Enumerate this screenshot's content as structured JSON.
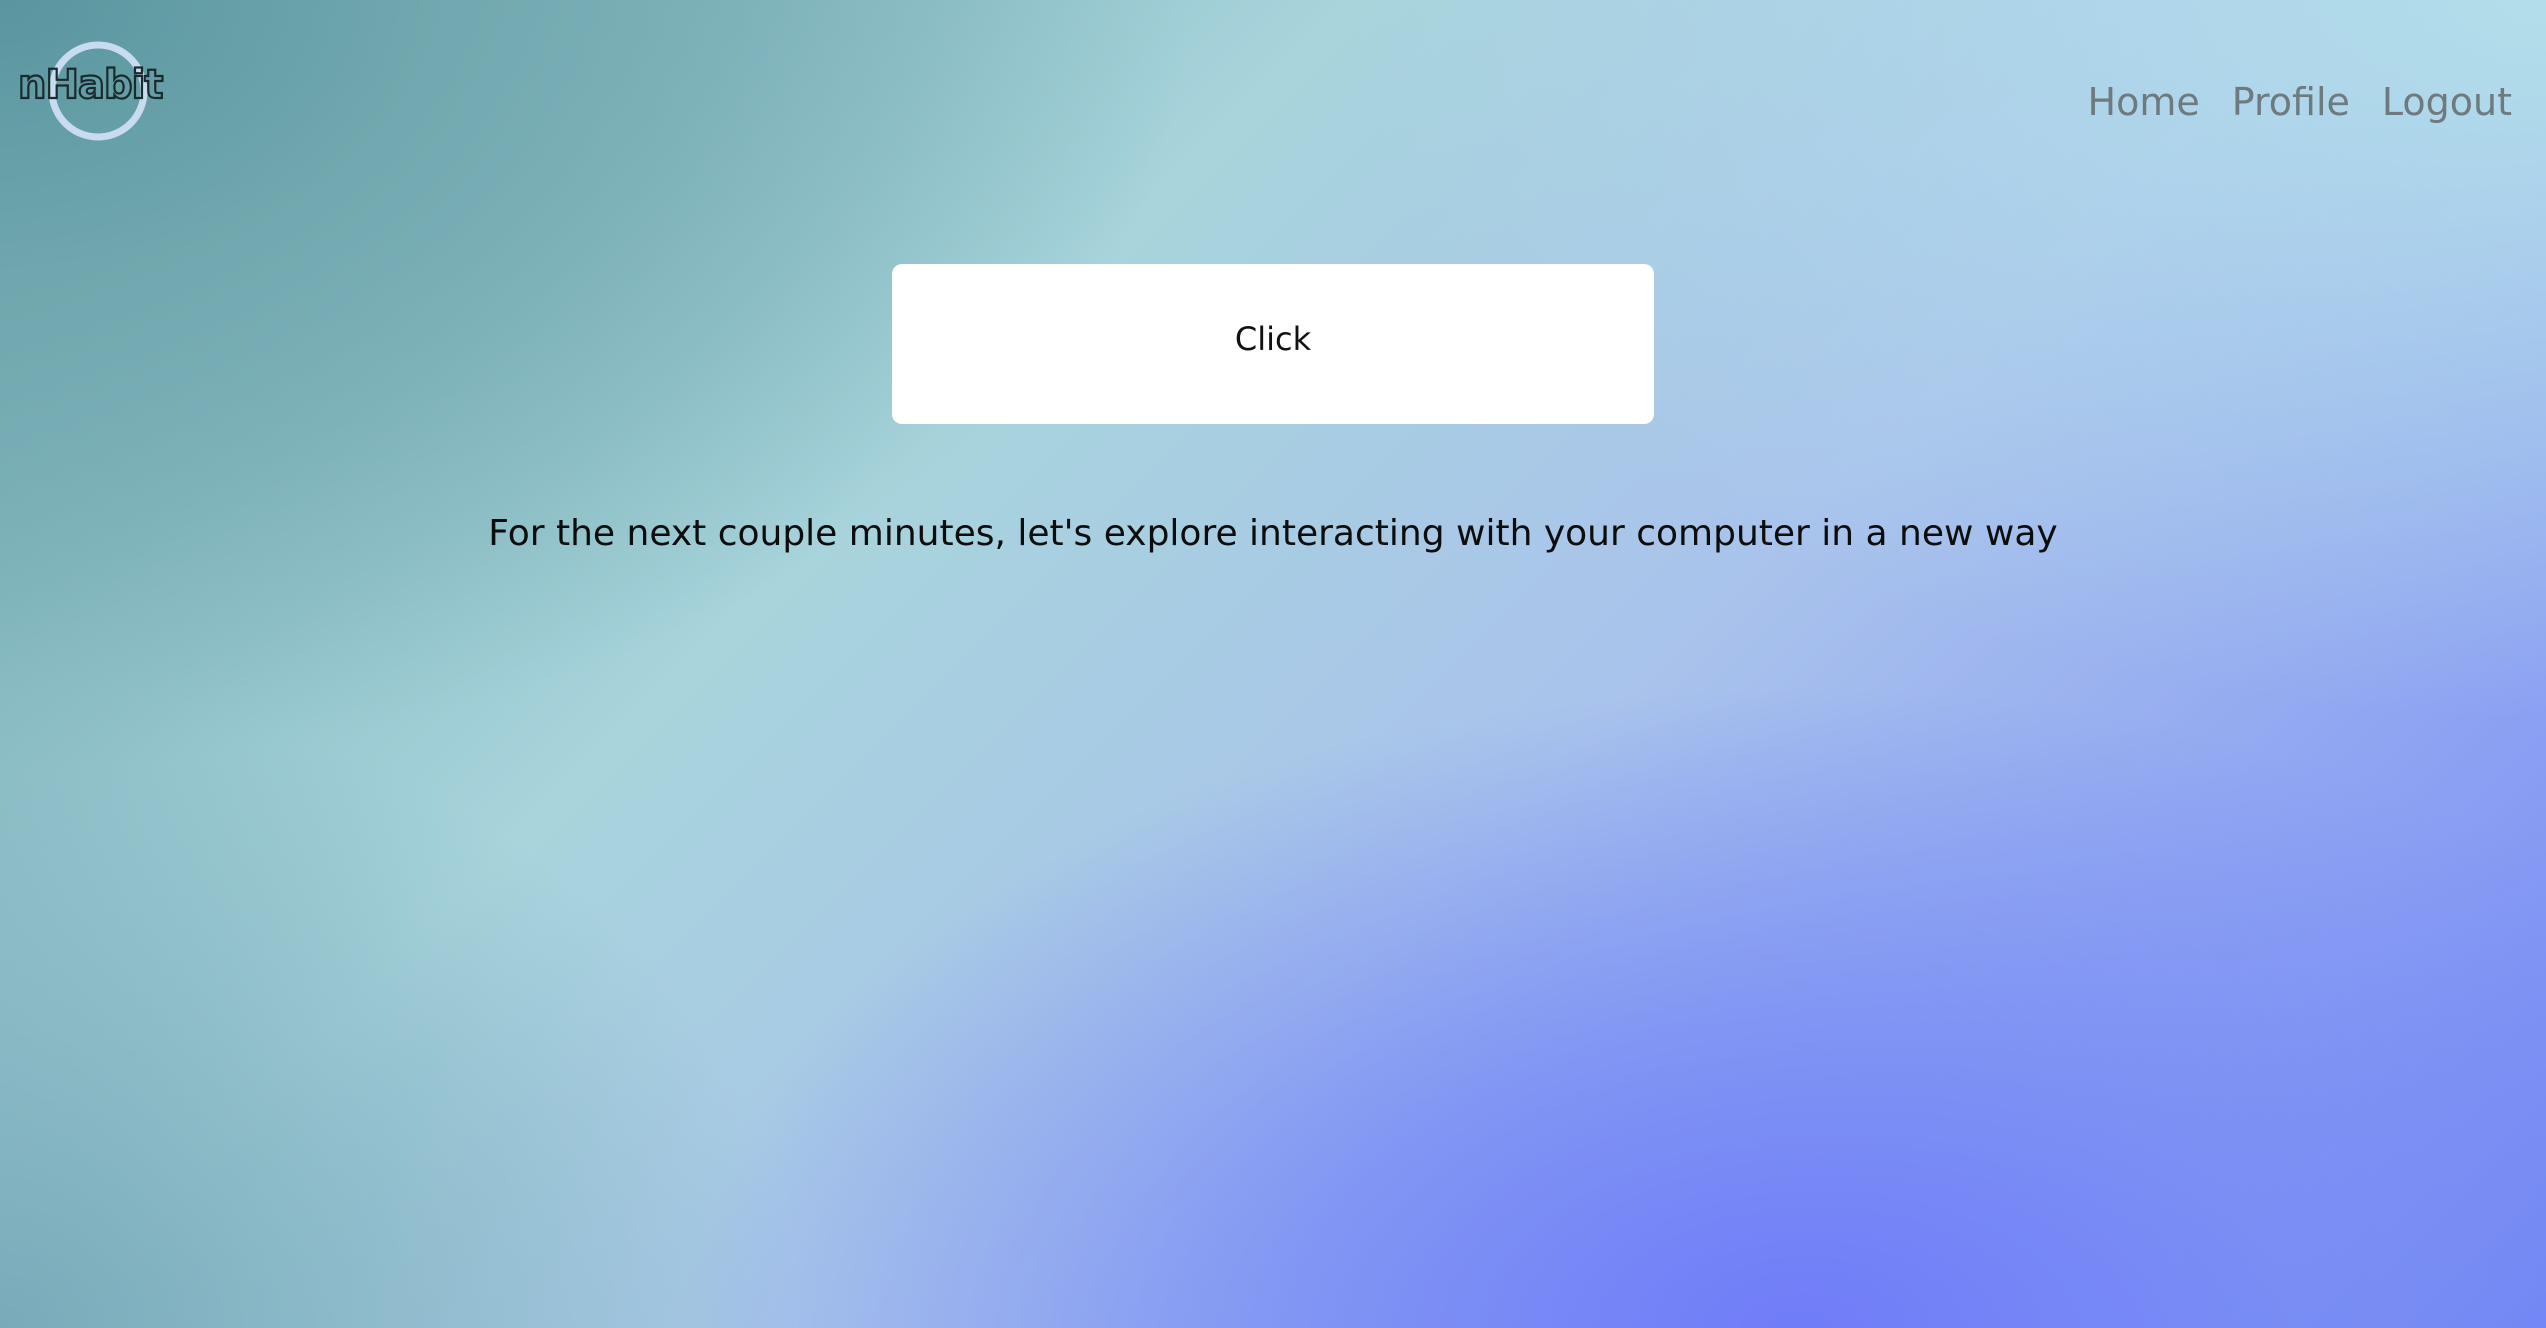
{
  "logo": {
    "text": "nHabit",
    "icon": "ring-logo-icon",
    "ring_color": "#c9dbee",
    "text_stroke": "#1b2a2c"
  },
  "nav": {
    "items": [
      {
        "label": "Home"
      },
      {
        "label": "Profile"
      },
      {
        "label": "Logout"
      }
    ]
  },
  "main": {
    "button_label": "Click",
    "prompt_text": "For the next couple minutes, let's explore interacting with your computer in a new way"
  },
  "colors": {
    "background_top_left": "#5f9ca4",
    "background_top_right": "#b4e0ea",
    "background_bottom_right": "#7082f7",
    "nav_link": "#6f7a7e",
    "button_bg": "#ffffff"
  }
}
